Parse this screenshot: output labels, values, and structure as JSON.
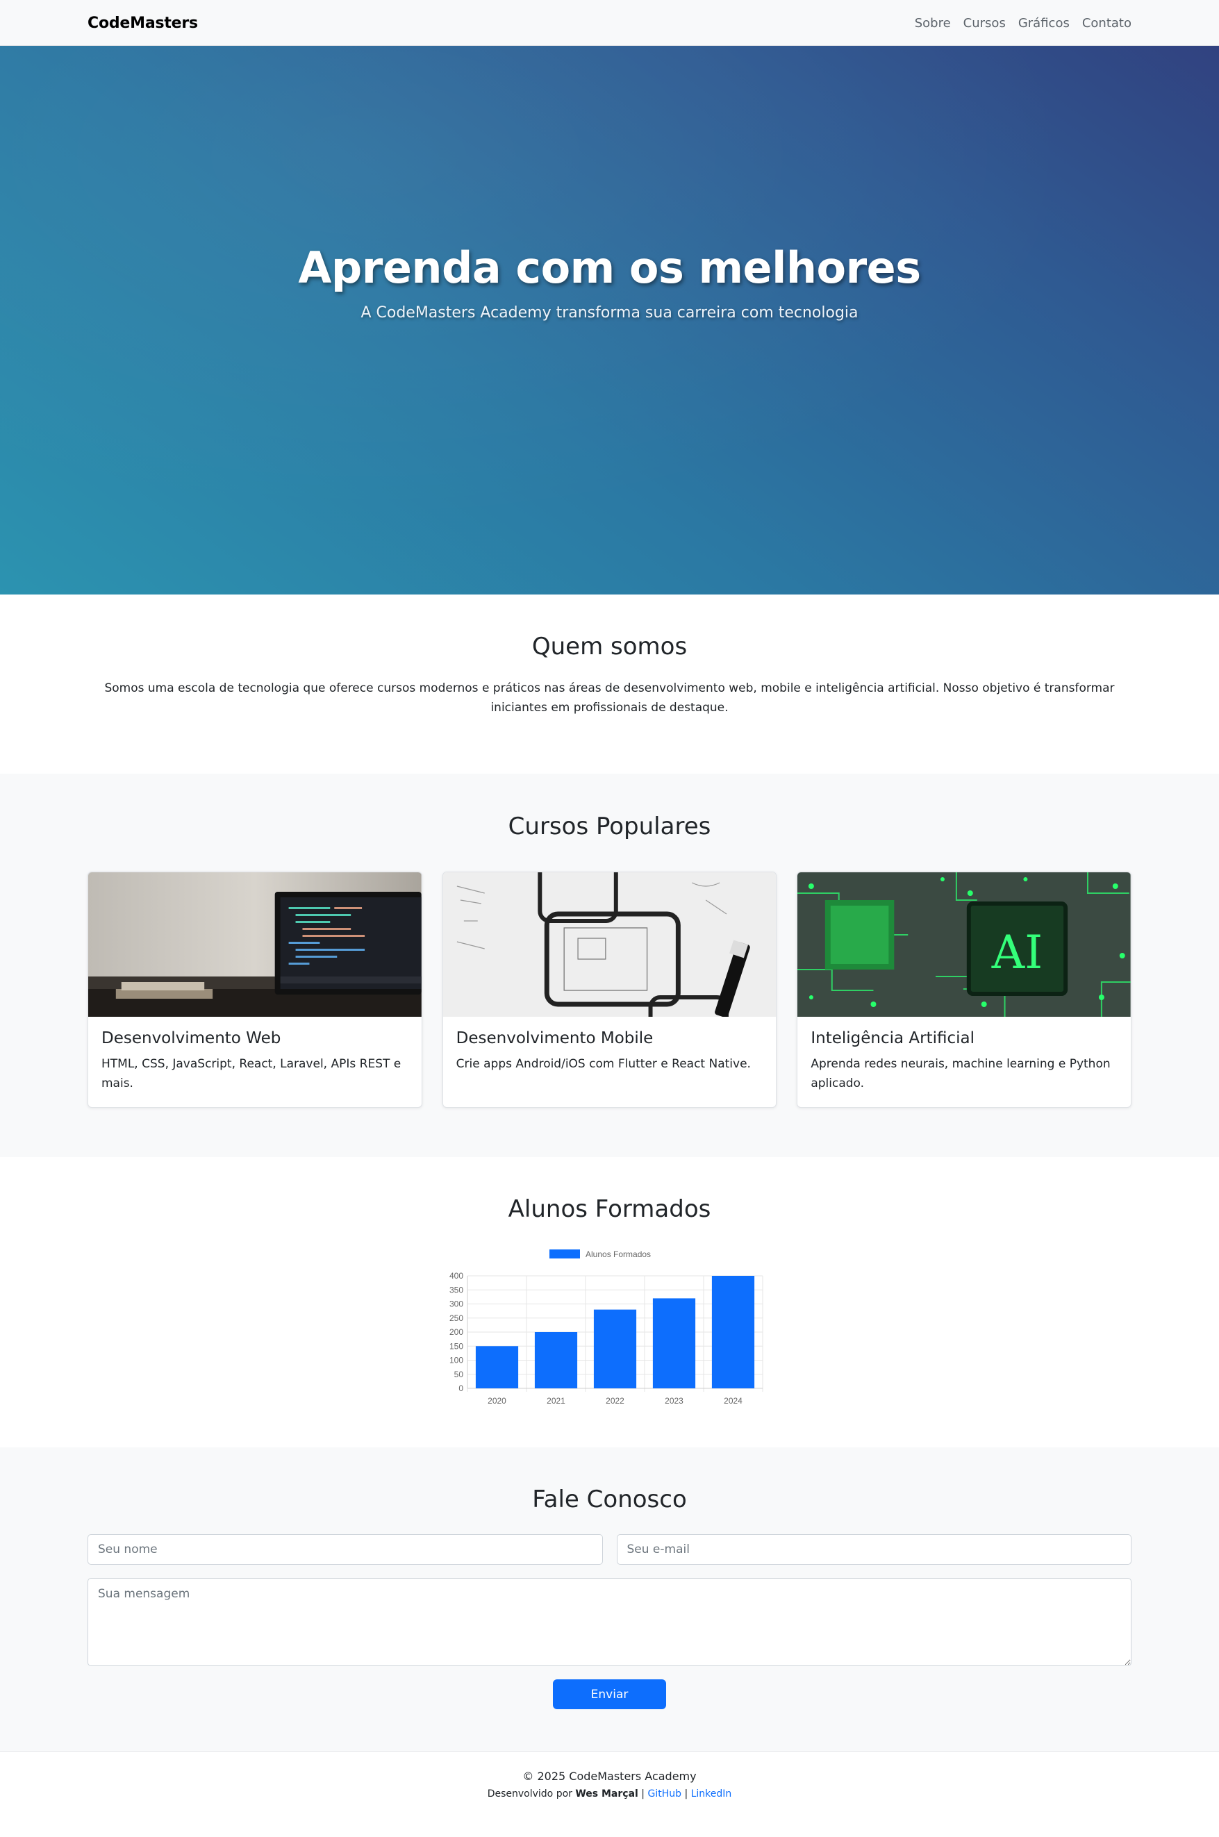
{
  "nav": {
    "brand": "CodeMasters",
    "links": [
      "Sobre",
      "Cursos",
      "Gráficos",
      "Contato"
    ]
  },
  "hero": {
    "title": "Aprenda com os melhores",
    "subtitle": "A CodeMasters Academy transforma sua carreira com tecnologia"
  },
  "about": {
    "heading": "Quem somos",
    "text": "Somos uma escola de tecnologia que oferece cursos modernos e práticos nas áreas de desenvolvimento web, mobile e inteligência artificial. Nosso objetivo é transformar iniciantes em profissionais de destaque."
  },
  "courses": {
    "heading": "Cursos Populares",
    "items": [
      {
        "title": "Desenvolvimento Web",
        "text": "HTML, CSS, JavaScript, React, Laravel, APIs REST e mais."
      },
      {
        "title": "Desenvolvimento Mobile",
        "text": "Crie apps Android/iOS com Flutter e React Native."
      },
      {
        "title": "Inteligência Artificial",
        "text": "Aprenda redes neurais, machine learning e Python aplicado."
      }
    ],
    "ai_image_text": "AI"
  },
  "chart_section": {
    "heading": "Alunos Formados"
  },
  "chart_data": {
    "type": "bar",
    "categories": [
      "2020",
      "2021",
      "2022",
      "2023",
      "2024"
    ],
    "series": [
      {
        "name": "Alunos Formados",
        "values": [
          150,
          200,
          280,
          320,
          400
        ],
        "color": "#0d6efd"
      }
    ],
    "yticks": [
      0,
      50,
      100,
      150,
      200,
      250,
      300,
      350,
      400
    ],
    "ylim": [
      0,
      400
    ],
    "grid": true,
    "legend": "top"
  },
  "contact": {
    "heading": "Fale Conosco",
    "name_placeholder": "Seu nome",
    "email_placeholder": "Seu e-mail",
    "message_placeholder": "Sua mensagem",
    "submit_label": "Enviar"
  },
  "footer": {
    "copyright": "© 2025 CodeMasters Academy",
    "credit_prefix": "Desenvolvido por",
    "author": "Wes Marçal",
    "sep": "|",
    "github": "GitHub",
    "linkedin": "LinkedIn"
  },
  "colors": {
    "primary": "#0d6efd",
    "hero_gradient_start": "#2c93b0",
    "hero_gradient_end": "#314280",
    "section_alt_bg": "#f8f9fa"
  }
}
